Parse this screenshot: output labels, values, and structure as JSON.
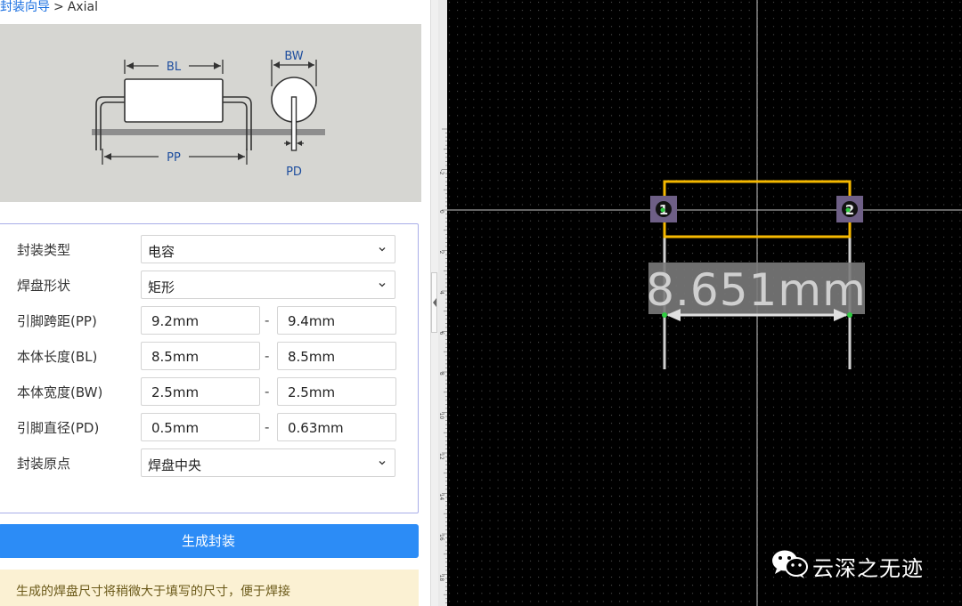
{
  "breadcrumb": {
    "link": "封装向导",
    "separator": ">",
    "current": "Axial"
  },
  "diagram": {
    "bl": "BL",
    "bw": "BW",
    "pp": "PP",
    "pd": "PD"
  },
  "form": {
    "package_type": {
      "label": "封装类型",
      "value": "电容"
    },
    "pad_shape": {
      "label": "焊盘形状",
      "value": "矩形"
    },
    "pin_pitch": {
      "label": "引脚跨距(PP)",
      "min": "9.2mm",
      "max": "9.4mm"
    },
    "body_length": {
      "label": "本体长度(BL)",
      "min": "8.5mm",
      "max": "8.5mm"
    },
    "body_width": {
      "label": "本体宽度(BW)",
      "min": "2.5mm",
      "max": "2.5mm"
    },
    "pin_diameter": {
      "label": "引脚直径(PD)",
      "min": "0.5mm",
      "max": "0.63mm"
    },
    "origin": {
      "label": "封装原点",
      "value": "焊盘中央"
    },
    "range_separator": "-"
  },
  "generate_button": "生成封装",
  "tip": "生成的焊盘尺寸将稍微大于填写的尺寸，便于焊接",
  "ruler_labels": [
    "-2",
    "0",
    "2",
    "4",
    "6",
    "8",
    "10",
    "12",
    "14",
    "16",
    "18"
  ],
  "pcb": {
    "pad1": "1",
    "pad2": "2",
    "dimension": "8.651mm"
  },
  "watermark": "云深之无迹",
  "colors": {
    "accent": "#2c8cf6",
    "silkscreen": "#f5b800",
    "canvas_bg": "#000000",
    "tip_bg": "#fbf1d3"
  }
}
